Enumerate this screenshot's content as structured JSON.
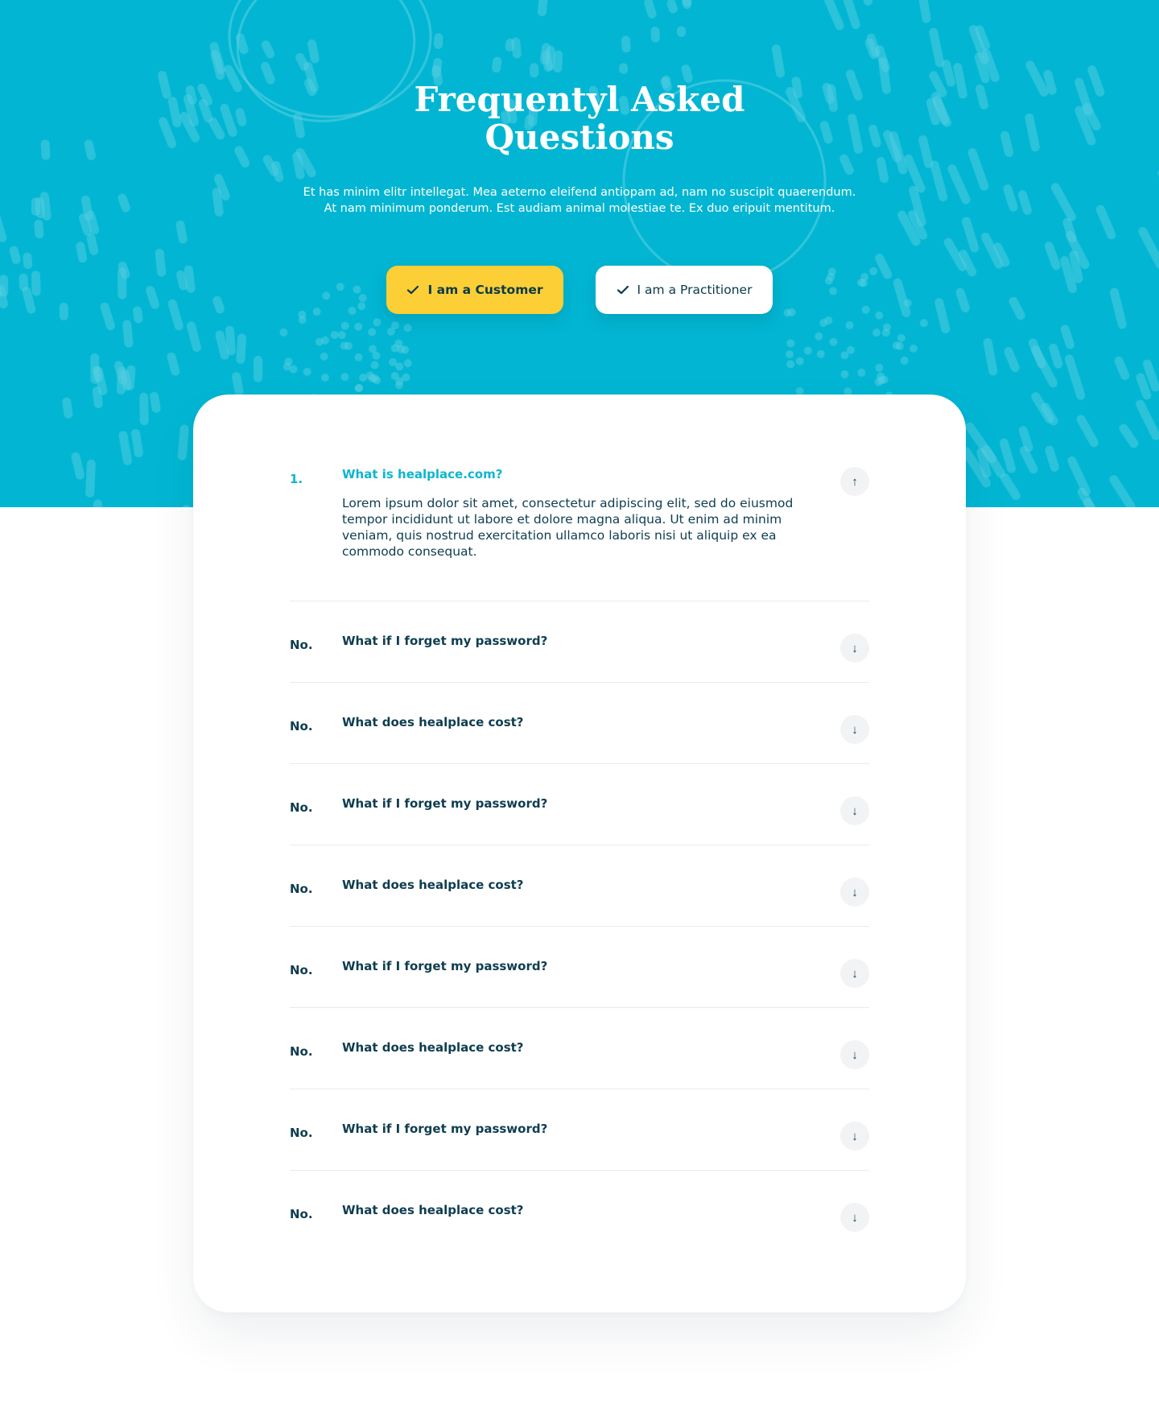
{
  "hero": {
    "title_line1": "Frequentyl Asked",
    "title_line2": "Questions",
    "subtitle": "Et has minim elitr intellegat. Mea aeterno eleifend antiopam ad, nam no suscipit quaerendum. At nam minimum ponderum. Est audiam animal molestiae te. Ex duo eripuit mentitum.",
    "customer_label": "I am a Customer",
    "practitioner_label": "I am a Practitioner",
    "colors": {
      "background": "#02b6d3",
      "customer_button": "#fbcf35",
      "accent_text": "#0fb5cf",
      "dark_text": "#0e3d50"
    }
  },
  "faq": {
    "items": [
      {
        "num": "1.",
        "question": "What is healplace.com?",
        "answer": "Lorem ipsum dolor sit amet, consectetur adipiscing elit, sed do eiusmod tempor incididunt ut labore et dolore magna aliqua. Ut enim ad minim veniam, quis nostrud exercitation ullamco laboris nisi ut aliquip ex ea commodo consequat.",
        "expanded": true,
        "toggle_icon": "↑"
      },
      {
        "num": "No.",
        "question": "What if I forget my password?",
        "expanded": false,
        "toggle_icon": "↓"
      },
      {
        "num": "No.",
        "question": "What does healplace cost?",
        "expanded": false,
        "toggle_icon": "↓"
      },
      {
        "num": "No.",
        "question": "What if I forget my password?",
        "expanded": false,
        "toggle_icon": "↓"
      },
      {
        "num": "No.",
        "question": "What does healplace cost?",
        "expanded": false,
        "toggle_icon": "↓"
      },
      {
        "num": "No.",
        "question": "What if I forget my password?",
        "expanded": false,
        "toggle_icon": "↓"
      },
      {
        "num": "No.",
        "question": "What does healplace cost?",
        "expanded": false,
        "toggle_icon": "↓"
      },
      {
        "num": "No.",
        "question": "What if I forget my password?",
        "expanded": false,
        "toggle_icon": "↓"
      },
      {
        "num": "No.",
        "question": "What does healplace cost?",
        "expanded": false,
        "toggle_icon": "↓"
      }
    ]
  }
}
